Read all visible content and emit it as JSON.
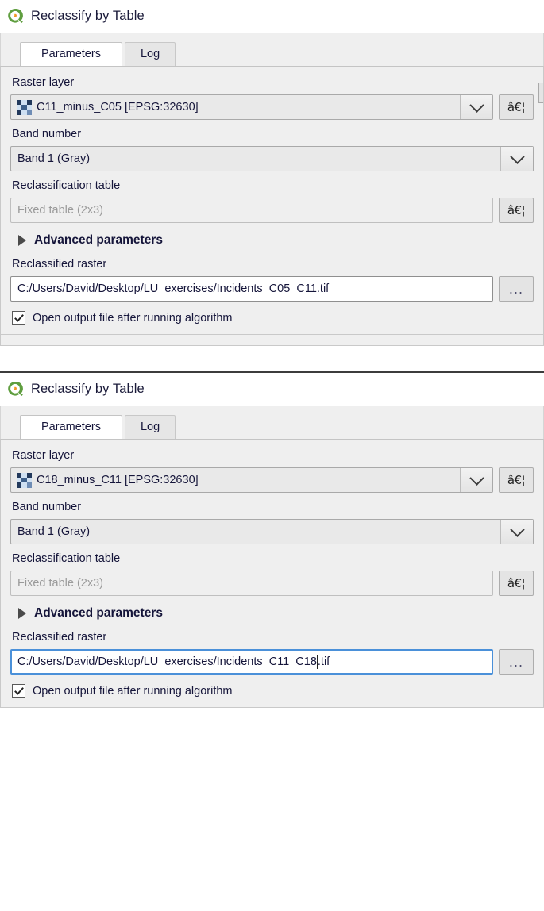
{
  "dialogs": [
    {
      "title": "Reclassify by Table",
      "logo_icon": "qgis-logo-icon",
      "tabs": [
        {
          "label": "Parameters",
          "active": true
        },
        {
          "label": "Log",
          "active": false
        }
      ],
      "fields": {
        "raster_layer_label": "Raster layer",
        "raster_layer_value": "C11_minus_C05 [EPSG:32630]",
        "raster_layer_icon": "raster-checker-icon",
        "raster_layer_dropdown_icon": "chevron-down-icon",
        "raster_layer_more_button": "â€¦",
        "band_number_label": "Band number",
        "band_number_value": "Band 1 (Gray)",
        "band_number_dropdown_icon": "chevron-down-icon",
        "reclass_table_label": "Reclassification table",
        "reclass_table_value": "Fixed table (2x3)",
        "reclass_table_more_button": "â€¦",
        "advanced_label": "Advanced parameters",
        "advanced_toggle_icon": "triangle-right-icon",
        "output_label": "Reclassified raster",
        "output_value": "C:/Users/David/Desktop/LU_exercises/Incidents_C05_C11.tif",
        "output_value_head": "C:/Users/David/Desktop/LU_exercises/Incidents_C05_C11.tif",
        "output_value_tail": "",
        "output_focused": false,
        "browse_button": "...",
        "open_output_label": "Open output file after running algorithm",
        "open_output_checked": true
      }
    },
    {
      "title": "Reclassify by Table",
      "logo_icon": "qgis-logo-icon",
      "tabs": [
        {
          "label": "Parameters",
          "active": true
        },
        {
          "label": "Log",
          "active": false
        }
      ],
      "fields": {
        "raster_layer_label": "Raster layer",
        "raster_layer_value": "C18_minus_C11 [EPSG:32630]",
        "raster_layer_icon": "raster-checker-icon",
        "raster_layer_dropdown_icon": "chevron-down-icon",
        "raster_layer_more_button": "â€¦",
        "band_number_label": "Band number",
        "band_number_value": "Band 1 (Gray)",
        "band_number_dropdown_icon": "chevron-down-icon",
        "reclass_table_label": "Reclassification table",
        "reclass_table_value": "Fixed table (2x3)",
        "reclass_table_more_button": "â€¦",
        "advanced_label": "Advanced parameters",
        "advanced_toggle_icon": "triangle-right-icon",
        "output_label": "Reclassified raster",
        "output_value": "C:/Users/David/Desktop/LU_exercises/Incidents_C11_C18.tif",
        "output_value_head": "C:/Users/David/Desktop/LU_exercises/Incidents_C11_C18",
        "output_value_tail": ".tif",
        "output_focused": true,
        "browse_button": "...",
        "open_output_label": "Open output file after running algorithm",
        "open_output_checked": true
      }
    }
  ],
  "colors": {
    "accent_focus": "#4a90d9",
    "panel_bg": "#efefef",
    "text": "#15153a",
    "placeholder": "#9a9a9a",
    "logo_green": "#5f9e3f",
    "logo_orange": "#f0932b"
  }
}
